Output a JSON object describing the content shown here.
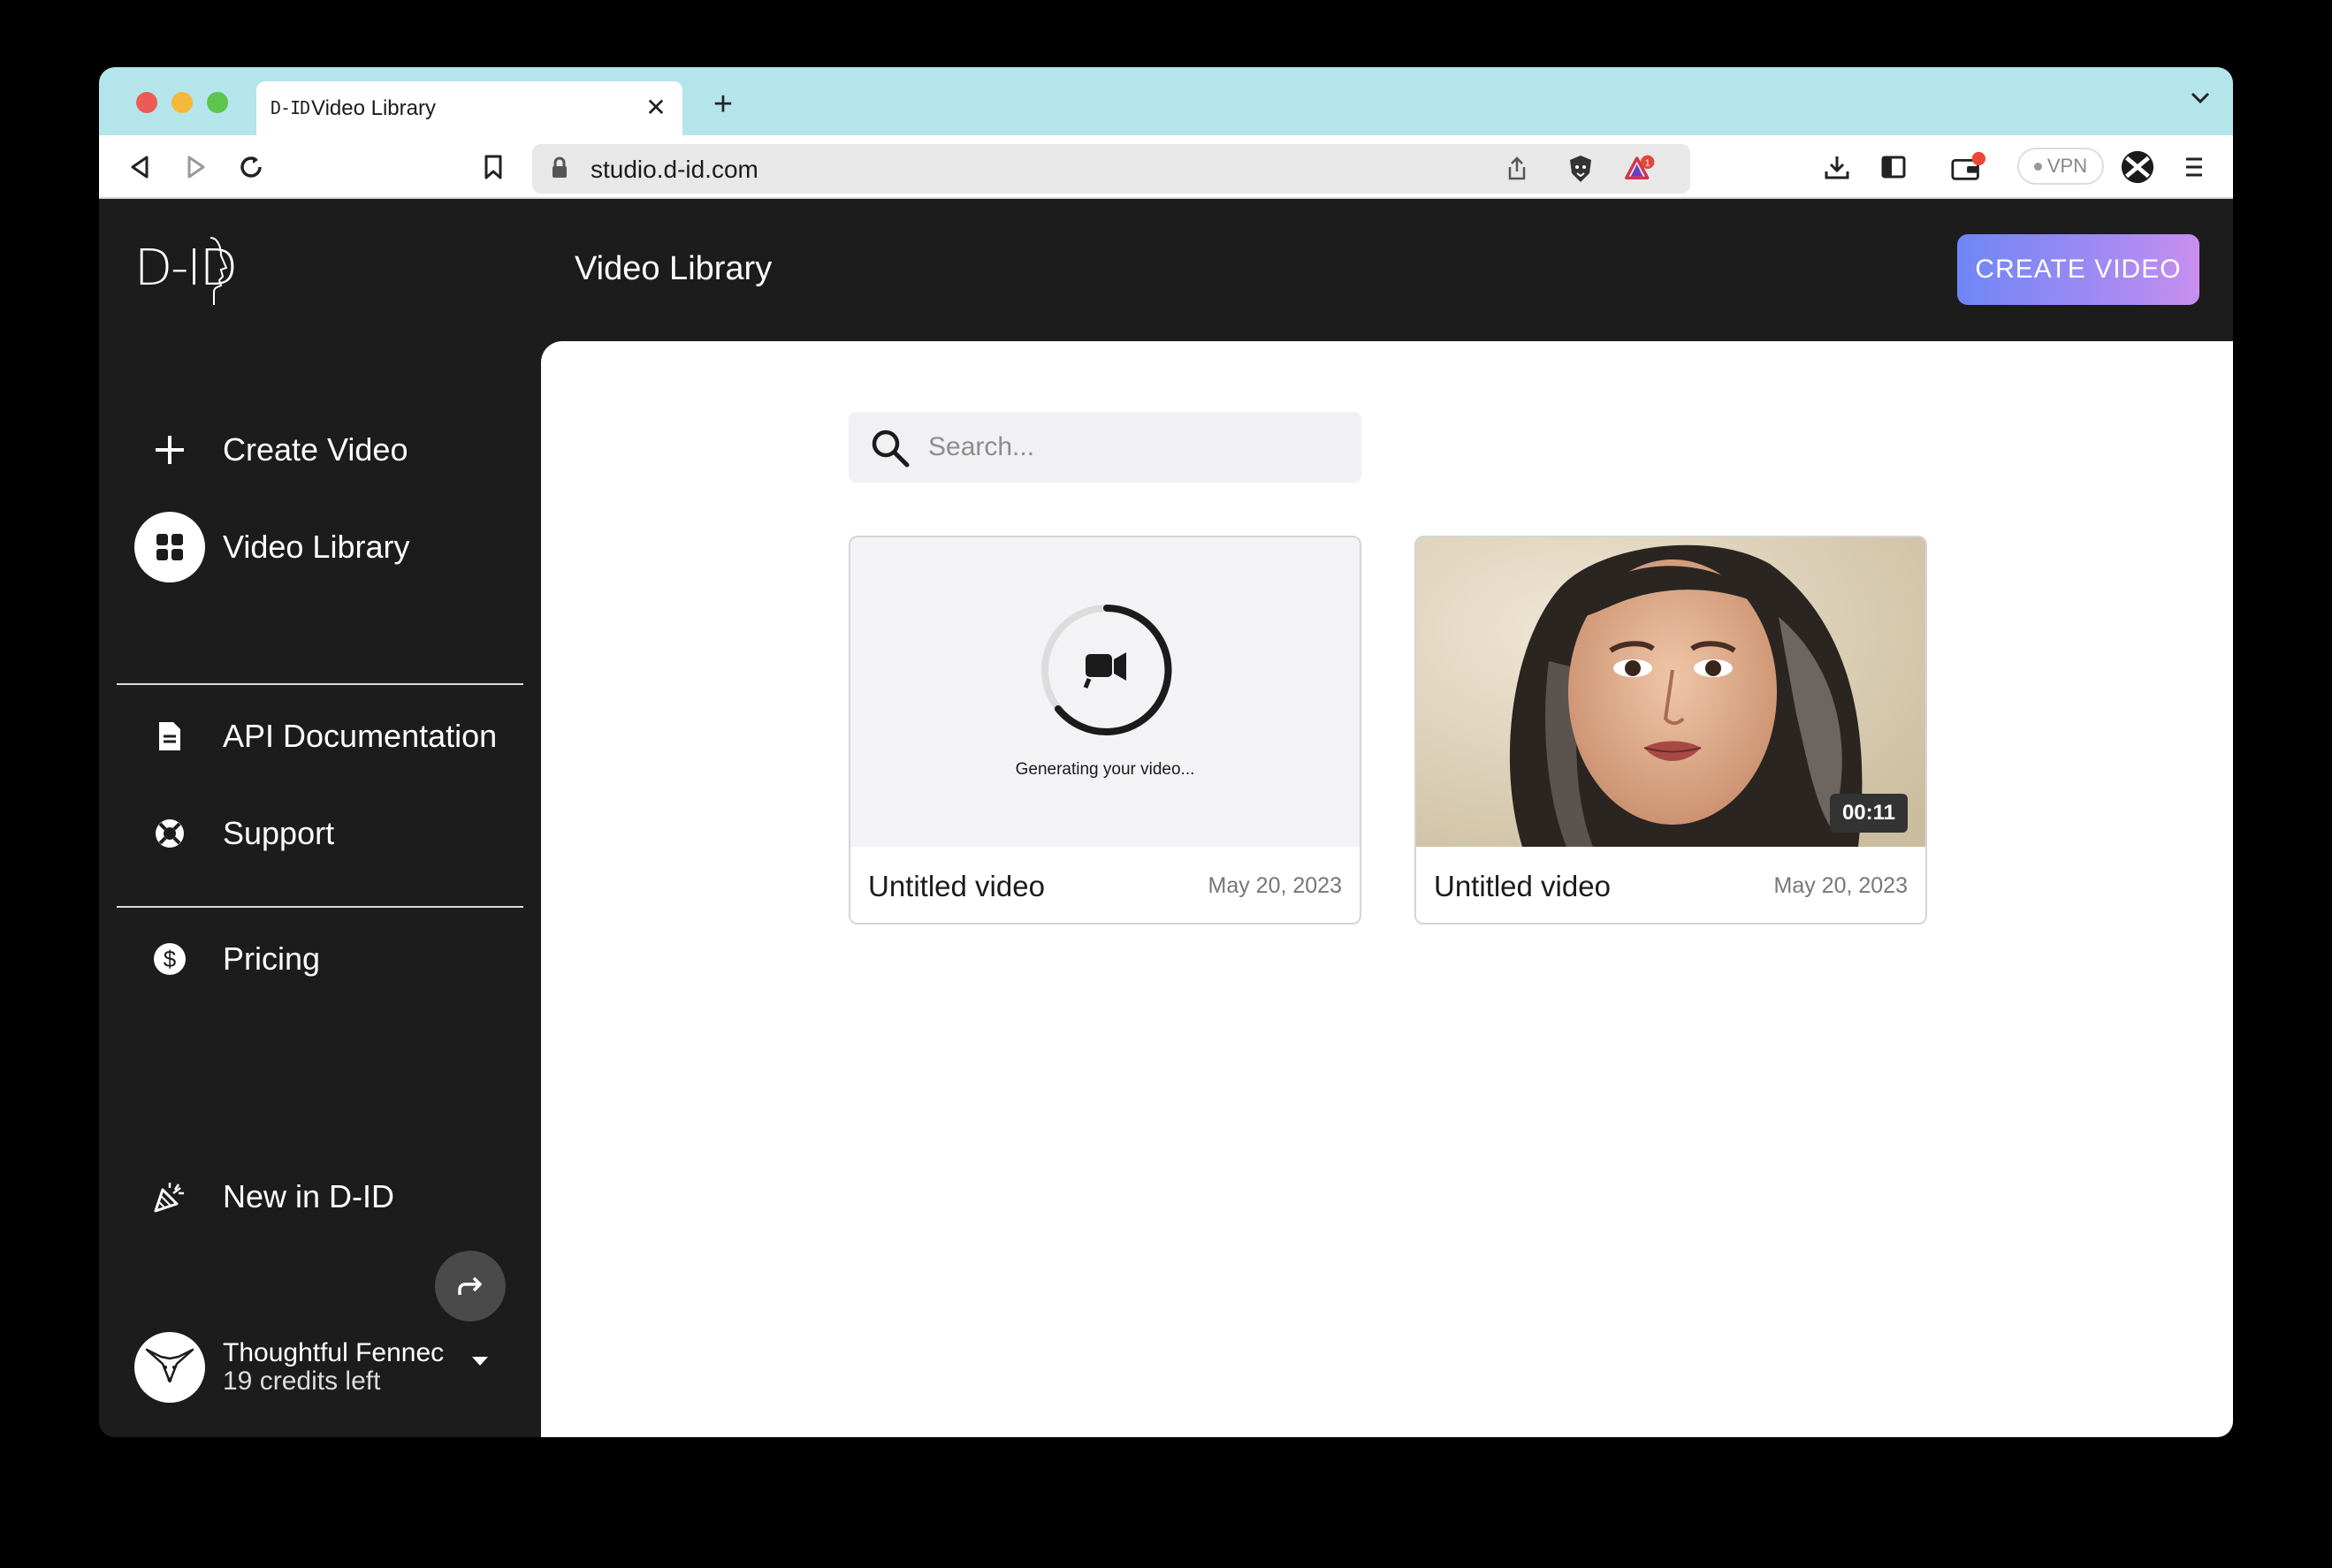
{
  "browser": {
    "tab_title": "Video Library",
    "tab_favicon": "D-ID",
    "url": "studio.d-id.com",
    "vpn_label": "VPN",
    "notification_count": "1"
  },
  "sidebar": {
    "logo_text": "D-ID",
    "items": [
      {
        "label": "Create Video",
        "icon": "plus-icon"
      },
      {
        "label": "Video Library",
        "icon": "grid-icon",
        "active": true
      },
      {
        "label": "API Documentation",
        "icon": "document-icon"
      },
      {
        "label": "Support",
        "icon": "lifebuoy-icon"
      },
      {
        "label": "Pricing",
        "icon": "dollar-icon"
      },
      {
        "label": "New in D-ID",
        "icon": "party-popper-icon"
      }
    ],
    "user": {
      "name": "Thoughtful Fennec",
      "credits": "19 credits left"
    }
  },
  "header": {
    "title": "Video Library",
    "create_button": "CREATE VIDEO"
  },
  "search": {
    "placeholder": "Search..."
  },
  "videos": [
    {
      "title": "Untitled video",
      "date": "May 20, 2023",
      "status": "Generating your video..."
    },
    {
      "title": "Untitled video",
      "date": "May 20, 2023",
      "duration": "00:11"
    }
  ],
  "colors": {
    "app_background": "#1c1c1c",
    "tab_strip": "#b3e5ea",
    "button_gradient_start": "#6f86f6",
    "button_gradient_end": "#c98ef0"
  }
}
